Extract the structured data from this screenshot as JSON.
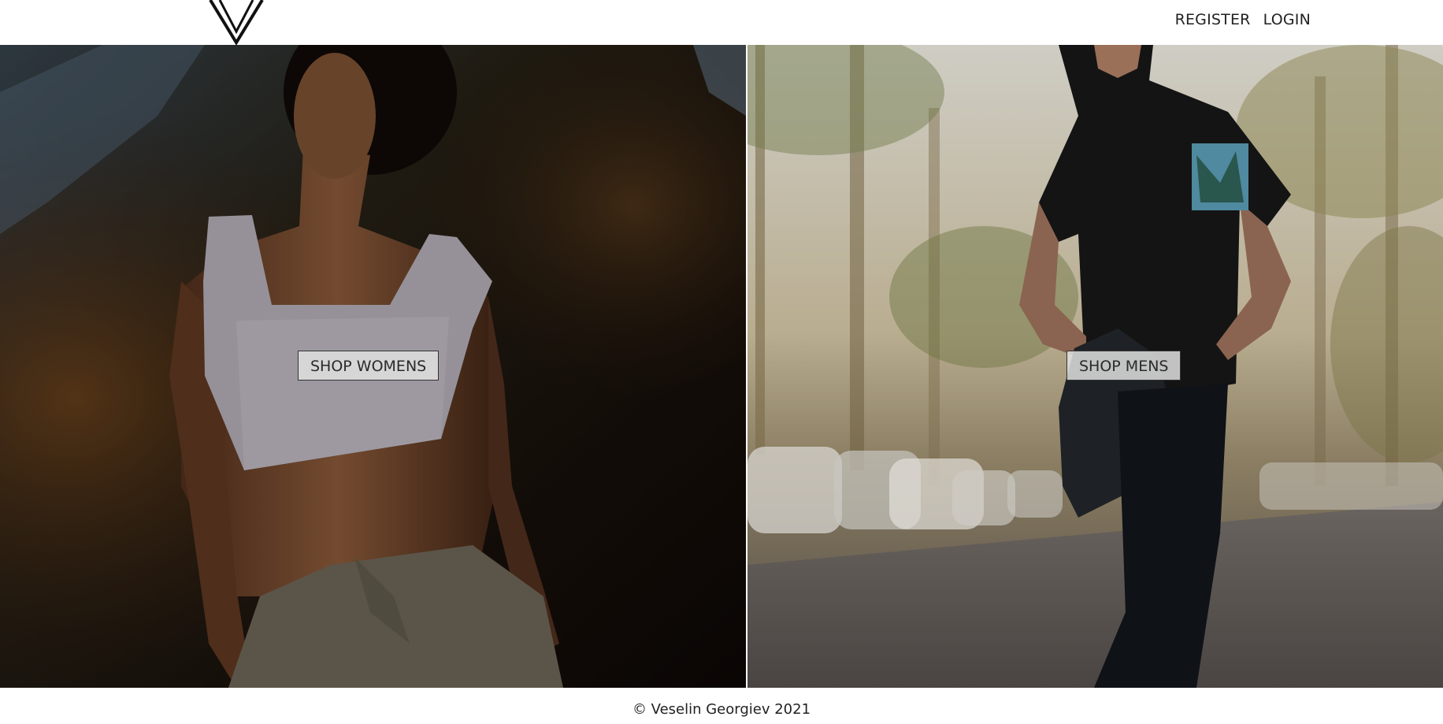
{
  "header": {
    "logo_name": "v-logo",
    "nav": {
      "register_label": "REGISTER",
      "login_label": "LOGIN"
    }
  },
  "hero": {
    "women": {
      "button_label": "SHOP WOMENS"
    },
    "men": {
      "button_label": "SHOP MENS"
    }
  },
  "footer": {
    "copyright": "© Veselin Georgiev 2021"
  },
  "colors": {
    "background": "#ffffff",
    "text": "#222222",
    "button_bg": "#e1e1e1",
    "button_border": "#333333"
  }
}
